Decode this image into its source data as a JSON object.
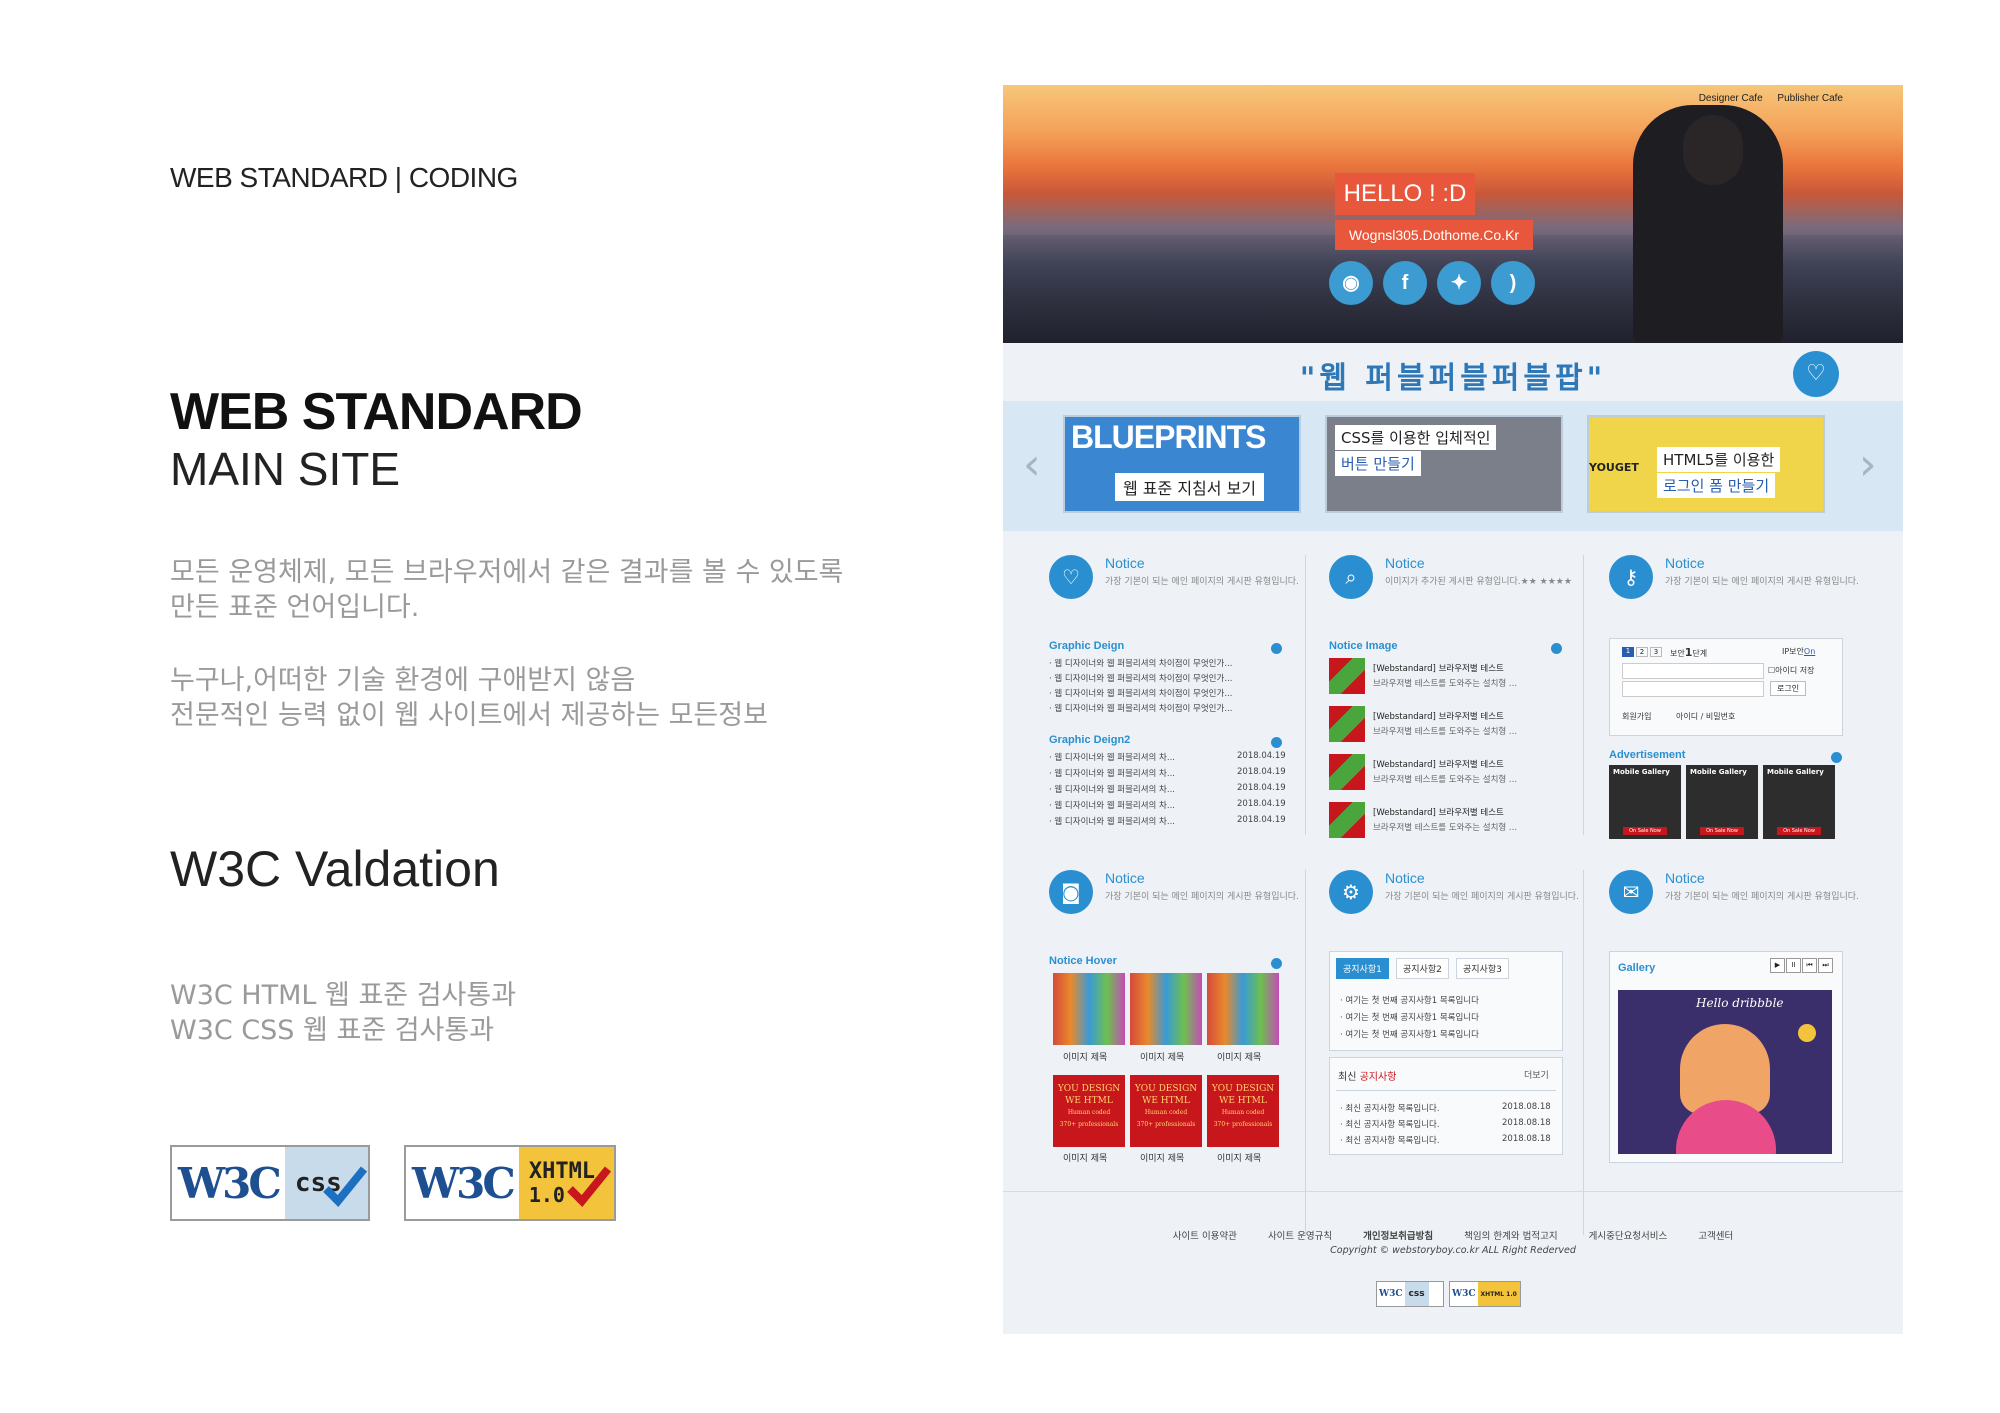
{
  "left": {
    "kicker": "WEB STANDARD | CODING",
    "title": "WEB STANDARD",
    "subtitle": "MAIN SITE",
    "desc1_line1": "모든 운영체제, 모든 브라우저에서 같은 결과를 볼 수 있도록",
    "desc1_line2": "만든 표준 언어입니다.",
    "desc2_line1": "누구나,어떠한 기술 환경에 구애받지 않음",
    "desc2_line2": "전문적인 능력 없이 웹 사이트에서 제공하는 모든정보",
    "validation_title": "W3C Valdation",
    "validation_line1": "W3C HTML 웹 표준 검사통과",
    "validation_line2": "W3C CSS 웹 표준 검사통과",
    "badge_css_w3": "W3C",
    "badge_css_label": "css",
    "badge_xhtml_w3": "W3C",
    "badge_xhtml_label1": "XHTML",
    "badge_xhtml_label2": "1.0"
  },
  "preview": {
    "toplinks": [
      "Designer Cafe",
      "Publisher Cafe"
    ],
    "hello": "HELLO ! :D",
    "domain": "Wognsl305.Dothome.Co.Kr",
    "slogan": "\"웹 퍼블퍼블퍼블팝\"",
    "slides": [
      {
        "title": "BLUEPRINTS",
        "caption": "웹 표준 지침서 보기"
      },
      {
        "title": "CSS를 이용한 입체적인",
        "caption": "버튼 만들기"
      },
      {
        "title": "HTML5를 이용한",
        "caption": "로그인 폼 만들기",
        "tag": "YOUGET"
      }
    ],
    "notices": [
      {
        "title": "Notice",
        "desc": "가장 기본이 되는 메인 페이지의 게시판 유형입니다."
      },
      {
        "title": "Notice",
        "desc": "이미지가 추가된 게시판 유형입니다.★★ ★★★★"
      },
      {
        "title": "Notice",
        "desc": "가장 기본이 되는 메인 페이지의 게시판 유형입니다."
      },
      {
        "title": "Notice",
        "desc": "가장 기본이 되는 메인 페이지의 게시판 유형입니다."
      },
      {
        "title": "Notice",
        "desc": "가장 기본이 되는 메인 페이지의 게시판 유형입니다."
      },
      {
        "title": "Notice",
        "desc": "가장 기본이 되는 메인 페이지의 게시판 유형입니다."
      }
    ],
    "graphic_design": {
      "title": "Graphic Deign",
      "items": [
        "· 웹 디자이너와 웹 퍼블리셔의 차이점이 무엇인가...",
        "· 웹 디자이너와 웹 퍼블리셔의 차이점이 무엇인가...",
        "· 웹 디자이너와 웹 퍼블리셔의 차이점이 무엇인가...",
        "· 웹 디자이너와 웹 퍼블리셔의 차이점이 무엇인가..."
      ]
    },
    "graphic_design2": {
      "title": "Graphic Deign2",
      "items": [
        {
          "text": "· 웹 디자이너와 웹 퍼블리셔의 차...",
          "date": "2018.04.19"
        },
        {
          "text": "· 웹 디자이너와 웹 퍼블리셔의 차...",
          "date": "2018.04.19"
        },
        {
          "text": "· 웹 디자이너와 웹 퍼블리셔의 차...",
          "date": "2018.04.19"
        },
        {
          "text": "· 웹 디자이너와 웹 퍼블리셔의 차...",
          "date": "2018.04.19"
        },
        {
          "text": "· 웹 디자이너와 웹 퍼블리셔의 차...",
          "date": "2018.04.19"
        }
      ]
    },
    "notice_image": {
      "title": "Notice Image",
      "items": [
        {
          "title": "[Webstandard] 브라우저별 테스트",
          "desc": "브라우저별 테스트를 도와주는 설치형 ..."
        },
        {
          "title": "[Webstandard] 브라우저별 테스트",
          "desc": "브라우저별 테스트를 도와주는 설치형 ..."
        },
        {
          "title": "[Webstandard] 브라우저별 테스트",
          "desc": "브라우저별 테스트를 도와주는 설치형 ..."
        },
        {
          "title": "[Webstandard] 브라우저별 테스트",
          "desc": "브라우저별 테스트를 도와주는 설치형 ..."
        }
      ]
    },
    "login": {
      "steps": [
        "1",
        "2",
        "3"
      ],
      "security_pre": "보안",
      "security_num": "1",
      "security_post": "단계",
      "ip_label": "IP보안",
      "ip_state": "On",
      "save_id": "아이디 저장",
      "login_btn": "로그인",
      "join": "회원가입",
      "find": "아이디 / 비밀번호"
    },
    "advertisement": {
      "title": "Advertisement",
      "items": [
        "Mobile Gallery",
        "Mobile Gallery",
        "Mobile Gallery"
      ],
      "cta": "On Sale Now"
    },
    "notice_hover": {
      "title": "Notice Hover",
      "captions": [
        "이미지 제목",
        "이미지 제목",
        "이미지 제목",
        "이미지 제목",
        "이미지 제목",
        "이미지 제목"
      ],
      "red_text1": "YOU DESIGN",
      "red_text2": "WE HTML",
      "red_text3": "Human coded",
      "red_text4": "370+ professionals"
    },
    "tabs": {
      "labels": [
        "공지사항1",
        "공지사항2",
        "공지사항3"
      ],
      "items": [
        "· 여기는 첫 번째 공지사항1 목록입니다",
        "· 여기는 첫 번째 공지사항1 목록입니다",
        "· 여기는 첫 번째 공지사항1 목록입니다"
      ]
    },
    "latest": {
      "title_pre": "최신",
      "title_hl": "공지사항",
      "more": "더보기",
      "items": [
        {
          "text": "· 최신 공지사항 목록입니다.",
          "date": "2018.08.18"
        },
        {
          "text": "· 최신 공지사항 목록입니다.",
          "date": "2018.08.18"
        },
        {
          "text": "· 최신 공지사항 목록입니다.",
          "date": "2018.08.18"
        }
      ]
    },
    "gallery": {
      "title": "Gallery",
      "controls": [
        "▶",
        "II",
        "⏮",
        "⏭"
      ],
      "art_text": "Hello dribbble"
    },
    "footer": {
      "links": [
        "사이트 이용약관",
        "사이트 운영규칙",
        "개인정보취급방침",
        "책임의 한계와 법적고지",
        "게시중단요청서비스",
        "고객센터"
      ],
      "copyright": "Copyright © webstoryboy.co.kr ALL Right Rederved",
      "badge_css": "css",
      "badge_xhtml": "XHTML 1.0"
    },
    "colors": {
      "accent": "#2a8fd0",
      "hello": "#e8573b"
    }
  }
}
